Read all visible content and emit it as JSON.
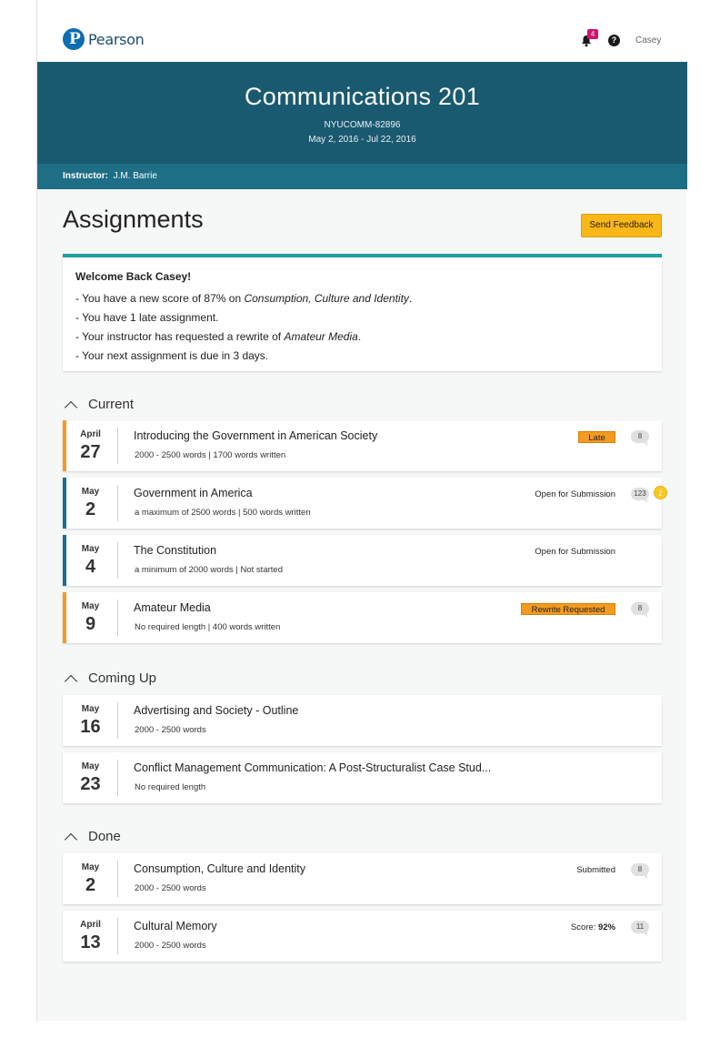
{
  "header": {
    "brand": "Pearson",
    "notification_count": "4",
    "help_glyph": "?",
    "user_name": "Casey"
  },
  "course": {
    "title": "Communications 201",
    "code": "NYUCOMM-82896",
    "dates": "May 2, 2016  -  Jul 22, 2016",
    "instructor_label": "Instructor:",
    "instructor_name": "J.M. Barrie"
  },
  "page": {
    "title": "Assignments",
    "feedback_button": "Send Feedback"
  },
  "welcome": {
    "heading": "Welcome Back Casey!",
    "line1_prefix": "- You have a new score of 87% on ",
    "line1_italic": "Consumption, Culture and Identity",
    "line1_suffix": ".",
    "line2": "- You have 1 late assignment.",
    "line3_prefix": "- Your instructor has requested a rewrite of ",
    "line3_italic": "Amateur Media",
    "line3_suffix": ".",
    "line4": "- Your next assignment is due in 3 days."
  },
  "sections": {
    "current": "Current",
    "coming_up": "Coming Up",
    "done": "Done"
  },
  "current": [
    {
      "month": "April",
      "day": "27",
      "title": "Introducing the Government in American Society",
      "sub": "2000 - 2500 words  |  1700 words written",
      "status": "Late",
      "comments": "8"
    },
    {
      "month": "May",
      "day": "2",
      "title": "Government in America",
      "sub": "a maximum of 2500 words  |  500 words written",
      "status": "Open for Submission",
      "comments": "123",
      "alert": "2"
    },
    {
      "month": "May",
      "day": "4",
      "title": "The Constitution",
      "sub": "a minimum of 2000 words  |  Not started",
      "status": "Open for Submission"
    },
    {
      "month": "May",
      "day": "9",
      "title": "Amateur Media",
      "sub": "No required length  |  400 words written",
      "status": "Rewrite Requested",
      "comments": "8"
    }
  ],
  "coming_up": [
    {
      "month": "May",
      "day": "16",
      "title": "Advertising and Society - Outline",
      "sub": "2000 - 2500 words"
    },
    {
      "month": "May",
      "day": "23",
      "title": "Conflict Management Communication: A Post-Structuralist Case Stud...",
      "sub": "No required length"
    }
  ],
  "done": [
    {
      "month": "May",
      "day": "2",
      "title": "Consumption, Culture and Identity",
      "sub": "2000 - 2500 words",
      "status": "Submitted",
      "comments": "8"
    },
    {
      "month": "April",
      "day": "13",
      "title": "Cultural Memory",
      "sub": "2000 - 2500 words",
      "score_label": "Score:",
      "score_value": "92%",
      "comments": "11"
    }
  ],
  "colors": {
    "hero": "#1a5a70",
    "instructor_bar": "#1e6e86",
    "late_stripe": "#f39b21",
    "open_stripe": "#1a6e93",
    "accent_yellow": "#fbb618",
    "welcome_border": "#1aa1a0"
  }
}
